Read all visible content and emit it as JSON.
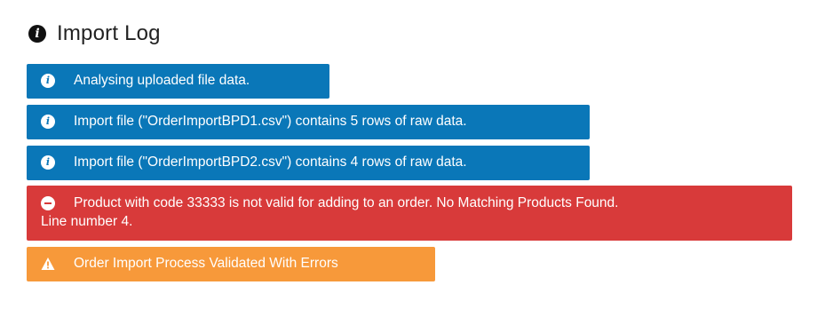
{
  "header": {
    "title": "Import Log",
    "icon": "info-icon"
  },
  "colors": {
    "info": "#0a77b8",
    "danger": "#d83a3a",
    "warning": "#f7993a"
  },
  "messages": [
    {
      "type": "info",
      "icon": "info-icon",
      "text": "Analysing uploaded file data."
    },
    {
      "type": "info",
      "icon": "info-icon",
      "text": "Import file (\"OrderImportBPD1.csv\") contains 5 rows of raw data."
    },
    {
      "type": "info",
      "icon": "info-icon",
      "text": "Import file (\"OrderImportBPD2.csv\") contains 4 rows of raw data."
    },
    {
      "type": "danger",
      "icon": "minus-circle-icon",
      "text": "Product with code 33333 is not valid for adding to an order. No Matching Products Found.",
      "detail": "Line number 4."
    },
    {
      "type": "warning",
      "icon": "warning-triangle-icon",
      "text": "Order Import Process Validated With Errors"
    }
  ]
}
